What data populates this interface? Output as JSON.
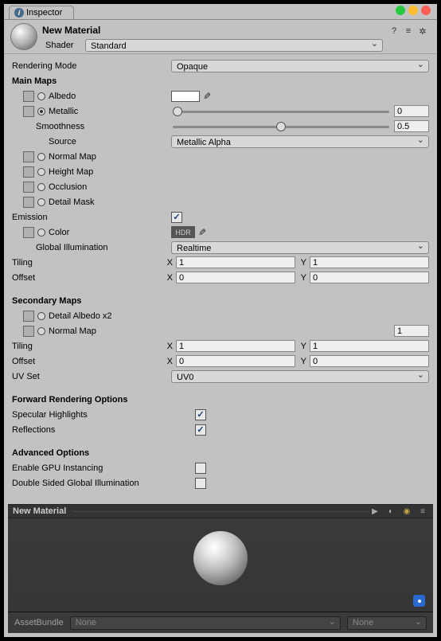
{
  "tab": {
    "label": "Inspector"
  },
  "header": {
    "name": "New Material",
    "shader_label": "Shader",
    "shader_value": "Standard"
  },
  "rendering_mode": {
    "label": "Rendering Mode",
    "value": "Opaque"
  },
  "main_maps": {
    "title": "Main Maps",
    "albedo": "Albedo",
    "metallic": "Metallic",
    "metallic_value": "0",
    "smoothness": "Smoothness",
    "smoothness_value": "0.5",
    "source": "Source",
    "source_value": "Metallic Alpha",
    "normal": "Normal Map",
    "height": "Height Map",
    "occlusion": "Occlusion",
    "detailmask": "Detail Mask",
    "emission": "Emission",
    "color": "Color",
    "hdr": "HDR",
    "gi": "Global Illumination",
    "gi_value": "Realtime",
    "tiling": "Tiling",
    "offset": "Offset",
    "tiling_x": "1",
    "tiling_y": "1",
    "offset_x": "0",
    "offset_y": "0"
  },
  "secondary": {
    "title": "Secondary Maps",
    "detail_albedo": "Detail Albedo x2",
    "normal": "Normal Map",
    "normal_value": "1",
    "tiling": "Tiling",
    "offset": "Offset",
    "tiling_x": "1",
    "tiling_y": "1",
    "offset_x": "0",
    "offset_y": "0",
    "uvset": "UV Set",
    "uvset_value": "UV0"
  },
  "forward": {
    "title": "Forward Rendering Options",
    "specular": "Specular Highlights",
    "reflections": "Reflections"
  },
  "advanced": {
    "title": "Advanced Options",
    "gpu": "Enable GPU Instancing",
    "dsgi": "Double Sided Global Illumination"
  },
  "preview": {
    "title": "New Material"
  },
  "footer": {
    "label": "AssetBundle",
    "main": "None",
    "variant": "None"
  },
  "axis": {
    "x": "X",
    "y": "Y"
  }
}
